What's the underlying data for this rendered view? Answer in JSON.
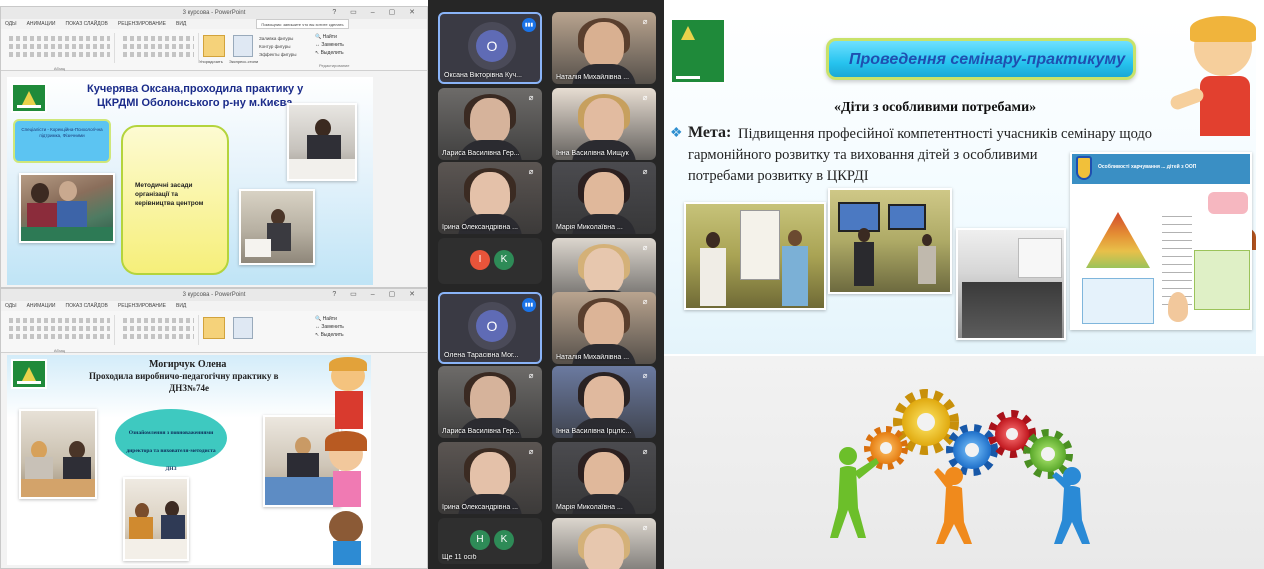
{
  "ppt_top": {
    "window_title": "3 курсова - PowerPoint",
    "tabs": [
      "ОДЫ",
      "АНИМАЦИИ",
      "ПОКАЗ СЛАЙДОВ",
      "РЕЦЕНЗИРОВАНИЕ",
      "ВИД"
    ],
    "ribbon_right": [
      "Найти",
      "Заменить",
      "Выделить"
    ],
    "ribbon_labels": [
      "Абзац",
      "Рисование",
      "Редактирование"
    ],
    "shape_options": [
      "Заливка фигуры",
      "Контур фигуры",
      "Эффекты фигуры"
    ],
    "tell_me": "Помощник: запишите что вы хотите сделать",
    "quick_styles": [
      "Упорядочить",
      "Экспресс-стили"
    ]
  },
  "slide1": {
    "title_line1": "Кучерява Оксана,проходила практику у",
    "title_line2": "ЦКРДМІ Оболонського р-ну м.Києва",
    "blue_box_text": "Спеціалісти - Корекційна-Психологічна підтримка, Фізичними",
    "yellow_box_text": "Методичні засади організації та керівництва центром"
  },
  "ppt_bottom": {
    "window_title": "3 курсова - PowerPoint",
    "tabs": [
      "ОДЫ",
      "АНИМАЦИИ",
      "ПОКАЗ СЛАЙДОВ",
      "РЕЦЕНЗИРОВАНИЕ",
      "ВИД"
    ],
    "ribbon_right": [
      "Найти",
      "Заменить",
      "Выделить"
    ],
    "ribbon_labels": [
      "Абзац",
      "Рисование",
      "Редактирование"
    ]
  },
  "slide2": {
    "title_line1": "Могирчук Олена",
    "title_line2": "Проходила виробничо-педагогічну практику в",
    "title_line3": "ДНЗ№74е",
    "oval_text": "Ознайомлення з повноваженнями директора та вихователя-методиста ДНЗ"
  },
  "video_grid": {
    "tiles": [
      {
        "name": "Оксана Вікторівна Куч...",
        "type": "avatar",
        "initials": "O",
        "avatar_color": "#5f6bb5",
        "speaking": true
      },
      {
        "name": "Наталія Михайлівна ...",
        "type": "video"
      },
      {
        "name": "Лариса Василівна Гер...",
        "type": "video"
      },
      {
        "name": "Інна Василівна Мищук",
        "type": "video"
      },
      {
        "name": "Ірина Олександрівна ...",
        "type": "video"
      },
      {
        "name": "Марія Миколаївна ...",
        "type": "video"
      },
      {
        "name": "",
        "type": "initials",
        "initials": [
          "I",
          "K"
        ]
      },
      {
        "name": "",
        "type": "video"
      },
      {
        "name": "Олена Тарасівна Мог...",
        "type": "avatar",
        "initials": "O",
        "avatar_color": "#5f6bb5",
        "speaking": true
      },
      {
        "name": "Наталія Михайлівна ...",
        "type": "video"
      },
      {
        "name": "Лариса Василівна Гер...",
        "type": "video"
      },
      {
        "name": "Інна Василівна Ірцліс...",
        "type": "video"
      },
      {
        "name": "Ірина Олександрівна ...",
        "type": "video"
      },
      {
        "name": "Марія Миколаївна ...",
        "type": "video"
      },
      {
        "name": "Ще 11 осіб",
        "type": "initials",
        "initials": [
          "H",
          "K"
        ]
      },
      {
        "name": "",
        "type": "video"
      }
    ]
  },
  "slide3": {
    "banner": "Проведення семінару-практикуму",
    "subtitle": "«Діти з особливими потребами»",
    "goal_label": "Мета:",
    "goal_text_line1": "Підвищення професійної компетентності учасників семінару щодо",
    "goal_text_line2": "гармонійного розвитку та виховання дітей з особливими",
    "goal_text_line3": "потребами  розвитку  в ЦКРДІ",
    "poster_header": "Особливості харчування ... дітей з ООП"
  },
  "colors": {
    "accent_green": "#1f8a3a",
    "banner_cyan": "#27c4ef",
    "banner_text": "#1f4fb0",
    "meet_dark": "#1f1f1f",
    "speaking_blue": "#1a73e8"
  }
}
